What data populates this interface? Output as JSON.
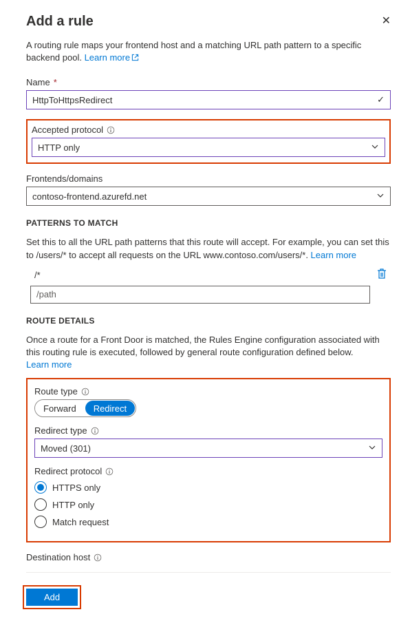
{
  "header": {
    "title": "Add a rule"
  },
  "intro": {
    "text": "A routing rule maps your frontend host and a matching URL path pattern to a specific backend pool. ",
    "learn_more": "Learn more"
  },
  "name_field": {
    "label": "Name",
    "value": "HttpToHttpsRedirect"
  },
  "protocol_field": {
    "label": "Accepted protocol",
    "value": "HTTP only"
  },
  "frontends_field": {
    "label": "Frontends/domains",
    "value": "contoso-frontend.azurefd.net"
  },
  "patterns": {
    "header": "PATTERNS TO MATCH",
    "help": "Set this to all the URL path patterns that this route will accept. For example, you can set this to /users/* to accept all requests on the URL www.contoso.com/users/*. ",
    "learn_more": "Learn more",
    "items": [
      "/*"
    ],
    "new_placeholder": "/path"
  },
  "route": {
    "header": "ROUTE DETAILS",
    "help": "Once a route for a Front Door is matched, the Rules Engine configuration associated with this routing rule is executed, followed by general route configuration defined below. ",
    "learn_more": "Learn more",
    "type_label": "Route type",
    "type_options": [
      "Forward",
      "Redirect"
    ],
    "type_selected": "Redirect",
    "redirect_type_label": "Redirect type",
    "redirect_type_value": "Moved (301)",
    "redirect_protocol_label": "Redirect protocol",
    "redirect_protocol_options": [
      "HTTPS only",
      "HTTP only",
      "Match request"
    ],
    "redirect_protocol_selected": "HTTPS only"
  },
  "destination_host_label": "Destination host",
  "add_button": "Add"
}
